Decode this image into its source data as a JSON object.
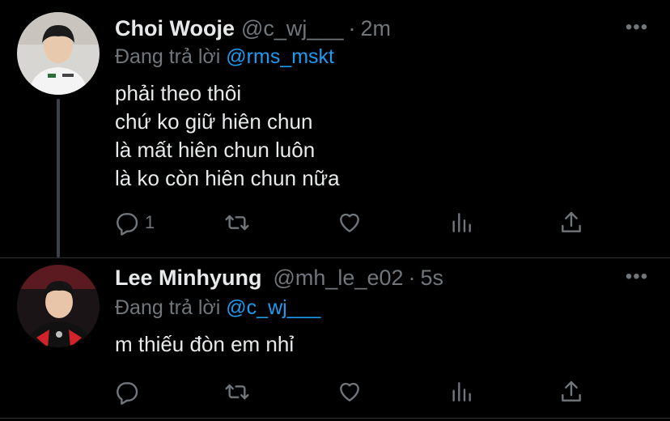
{
  "tweets": [
    {
      "name": "Choi Wooje",
      "handle": "@c_wj___",
      "separator": "·",
      "time": "2m",
      "replying_prefix": "Đang trả lời",
      "replying_to": "@rms_mskt",
      "lines": [
        "phải theo thôi",
        "chứ ko giữ hiên chun",
        "là mất hiên chun luôn",
        "là ko còn hiên chun nữa"
      ],
      "reply_count": "1",
      "more_label": "•••"
    },
    {
      "name": "Lee Minhyung",
      "handle": "@mh_le_e02",
      "separator": "·",
      "time": "5s",
      "replying_prefix": "Đang trả lời",
      "replying_to": "@c_wj___",
      "lines": [
        "m thiếu đòn em nhỉ"
      ],
      "reply_count": "",
      "more_label": "•••"
    }
  ],
  "icons": {
    "reply": "reply-icon",
    "retweet": "retweet-icon",
    "like": "heart-icon",
    "stats": "stats-icon",
    "share": "share-icon"
  },
  "colors": {
    "background": "#000000",
    "text": "#e7e9ea",
    "muted": "#71767b",
    "accent": "#1d9bf0"
  }
}
